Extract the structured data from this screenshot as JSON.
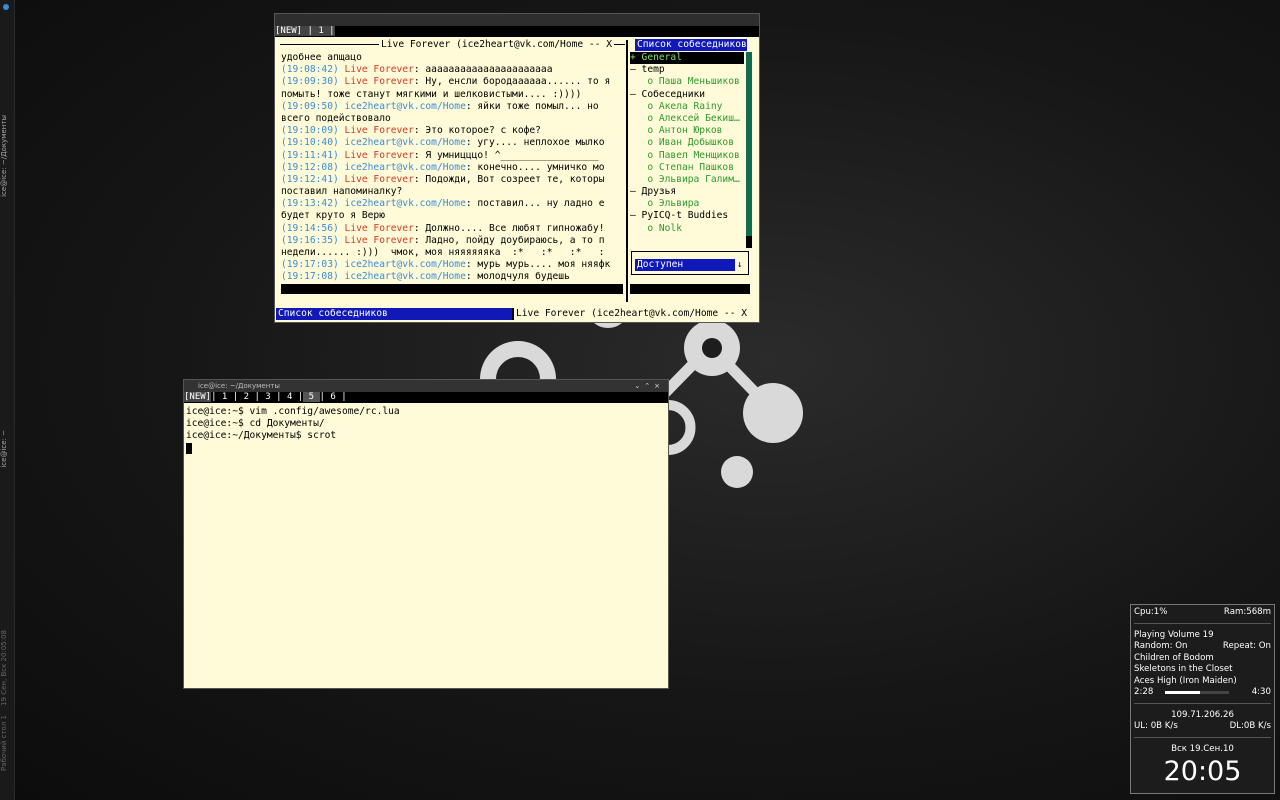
{
  "side_panel": {
    "top_label": "ice@ice: ~/Документы",
    "mid_label": "ice@ice: ~",
    "date_label": "19 Сен, Вск 20:05:08",
    "desktop_label": "Рабочий стол 1"
  },
  "chat_window": {
    "tabbar": "[NEW] | 1 |",
    "conversation_title": "Live Forever (ice2heart@vk.com/Home -- X",
    "messages": [
      {
        "ts": "",
        "nick": "",
        "nick_type": "",
        "text": "удобнее апщацо"
      },
      {
        "ts": "(19:08:42)",
        "nick": "Live Forever",
        "nick_type": "lf",
        "text": ": аааааааааааааааааааааа"
      },
      {
        "ts": "(19:09:30)",
        "nick": "Live Forever",
        "nick_type": "lf",
        "text": ": Ну, енсли бородаааааа...... то я"
      },
      {
        "ts": "",
        "nick": "",
        "nick_type": "",
        "text": "помыть! тоже станут мягкими и шелковистыми.... :))))"
      },
      {
        "ts": "(19:09:50)",
        "nick": "ice2heart@vk.com/Home",
        "nick_type": "ice",
        "text": ": яйки тоже помыл... но"
      },
      {
        "ts": "",
        "nick": "",
        "nick_type": "",
        "text": "всего подействовало"
      },
      {
        "ts": "(19:10:09)",
        "nick": "Live Forever",
        "nick_type": "lf",
        "text": ": Это которое? с кофе?"
      },
      {
        "ts": "(19:10:40)",
        "nick": "ice2heart@vk.com/Home",
        "nick_type": "ice",
        "text": ": угу.... неплохое мылко"
      },
      {
        "ts": "(19:11:41)",
        "nick": "Live Forever",
        "nick_type": "lf",
        "text": ": Я умницццо! ^_________________"
      },
      {
        "ts": "(19:12:08)",
        "nick": "ice2heart@vk.com/Home",
        "nick_type": "ice",
        "text": ": конечно.... умничко мо"
      },
      {
        "ts": "(19:12:41)",
        "nick": "Live Forever",
        "nick_type": "lf",
        "text": ": Подожди, Вот созреет те, которы"
      },
      {
        "ts": "",
        "nick": "",
        "nick_type": "",
        "text": "поставил напоминалку?"
      },
      {
        "ts": "(19:13:42)",
        "nick": "ice2heart@vk.com/Home",
        "nick_type": "ice",
        "text": ": поставил... ну ладно е"
      },
      {
        "ts": "",
        "nick": "",
        "nick_type": "",
        "text": "будет круто я Верю"
      },
      {
        "ts": "(19:14:56)",
        "nick": "Live Forever",
        "nick_type": "lf",
        "text": ": Должно.... Все любят гипножабу!"
      },
      {
        "ts": "(19:16:35)",
        "nick": "Live Forever",
        "nick_type": "lf",
        "text": ": Ладно, пойду доубираюсь, а то п"
      },
      {
        "ts": "",
        "nick": "",
        "nick_type": "",
        "text": "недели...... :)))  чмок, моя няяяяяяка  :*   :*   :*   :"
      },
      {
        "ts": "(19:17:03)",
        "nick": "ice2heart@vk.com/Home",
        "nick_type": "ice",
        "text": ": мурь мурь.... моя няяфк"
      },
      {
        "ts": "(19:17:08)",
        "nick": "ice2heart@vk.com/Home",
        "nick_type": "ice",
        "text": ": молодчуля будешь"
      }
    ],
    "contacts_header": "Список собеседников",
    "contacts": [
      {
        "type": "group",
        "text": "+ General",
        "selected": true
      },
      {
        "type": "group",
        "text": "– temp"
      },
      {
        "type": "item",
        "text": "   o Паша Меньшиков"
      },
      {
        "type": "group",
        "text": "– Собеседники"
      },
      {
        "type": "item",
        "text": "   o Акела Rainy"
      },
      {
        "type": "item",
        "text": "   o Алексей Бекиш…"
      },
      {
        "type": "item",
        "text": "   o Антон Юрков"
      },
      {
        "type": "item",
        "text": "   o Иван Добышков"
      },
      {
        "type": "item",
        "text": "   o Павел Менщиков"
      },
      {
        "type": "item",
        "text": "   o Степан Пашков"
      },
      {
        "type": "item",
        "text": "   o Эльвира Галим…"
      },
      {
        "type": "group",
        "text": "– Друзья"
      },
      {
        "type": "item",
        "text": "   o Эльвира"
      },
      {
        "type": "group",
        "text": "– PyICQ-t Buddies"
      },
      {
        "type": "item",
        "text": "   o Nolk"
      }
    ],
    "status_value": "Доступен",
    "status_arrow": "↓",
    "bottom_left": "Список собеседников",
    "bottom_right": "Live Forever (ice2heart@vk.com/Home -- X"
  },
  "terminal_window": {
    "title": "ice@ice: ~/Документы",
    "tabs": [
      {
        "label": "[NEW]",
        "active": false,
        "new": true
      },
      {
        "label": " 1 ",
        "active": false
      },
      {
        "label": " 2 ",
        "active": false
      },
      {
        "label": " 3 ",
        "active": false
      },
      {
        "label": " 4 ",
        "active": false
      },
      {
        "label": " 5 ",
        "active": true
      },
      {
        "label": " 6 ",
        "active": false
      }
    ],
    "lines": [
      "ice@ice:~$ vim .config/awesome/rc.lua",
      "ice@ice:~$ cd Документы/",
      "ice@ice:~/Документы$ scrot"
    ]
  },
  "widget": {
    "cpu": "Cpu:1%",
    "ram": "Ram:568m",
    "playing": "Playing Volume 19",
    "random": "Random: On",
    "repeat": "Repeat: On",
    "artist": "Children of Bodom",
    "album": "Skeletons in the Closet",
    "track": "Aces High (Iron Maiden)",
    "elapsed": "2:28",
    "total": "4:30",
    "progress": 0.55,
    "ip": "109.71.206.26",
    "ul": "UL: 0B  K/s",
    "dl": "DL:0B  K/s",
    "date": "Вск 19.Сен.10",
    "time": "20:05"
  }
}
